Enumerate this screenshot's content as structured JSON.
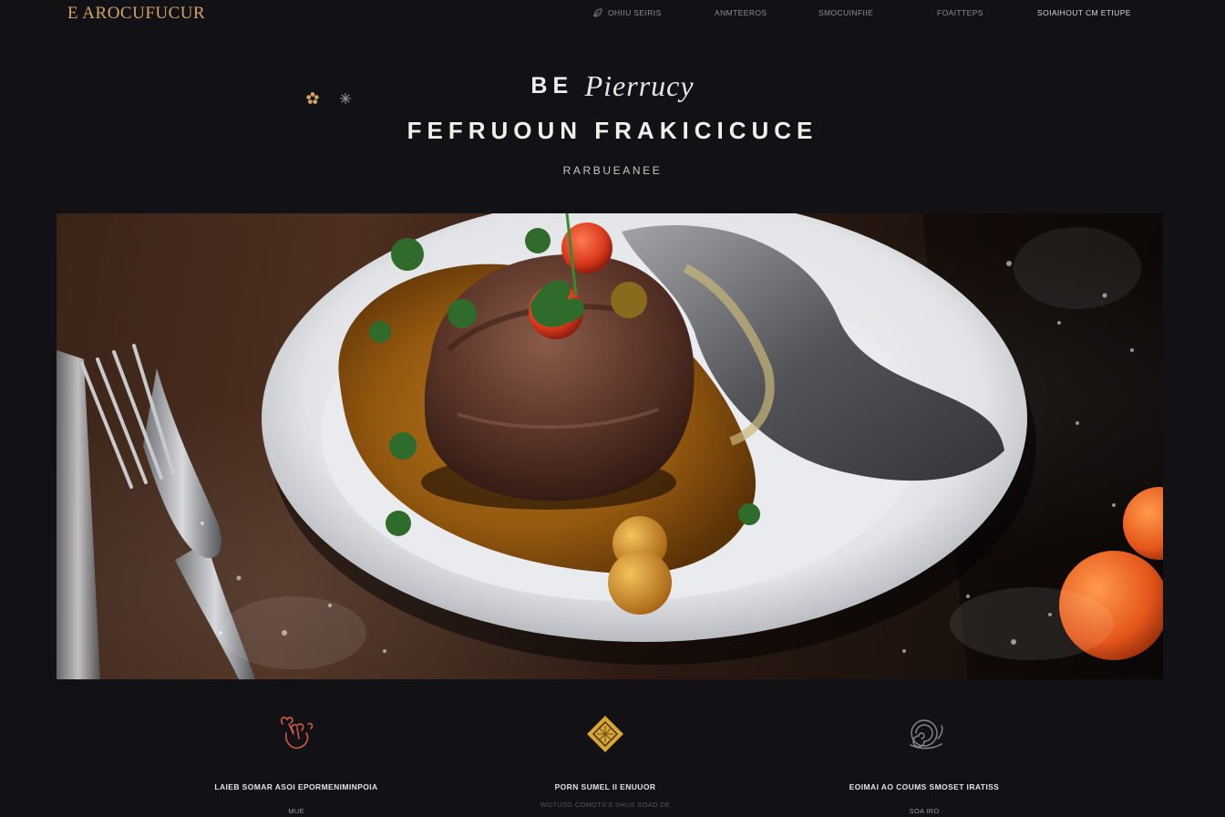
{
  "brand": {
    "logo_text": "E AROCUFUCUR"
  },
  "nav": {
    "links": [
      {
        "label": "OHIIU SEIRIS"
      },
      {
        "label": "ANMTEEROS"
      },
      {
        "label": "SMOCUINFIIE"
      },
      {
        "label": "FOAITTEPS"
      },
      {
        "label": "SOIAIHOUT CM ETIUPE"
      }
    ]
  },
  "hero": {
    "prefix": "BE",
    "script_word": "Pierrucy",
    "title": "FEFRUOUN FRAKICICUCE",
    "subtitle": "RARBUEANEE"
  },
  "features": [
    {
      "title": "LAIEB SOMAR ASOI EPORMENIMINPOIA",
      "subtitle": "MUE",
      "description": ""
    },
    {
      "title": "PORN SUMEL II ENUUOR",
      "subtitle": "",
      "description": "WOTUSG COMOTS'S SHUS SOAD DE"
    },
    {
      "title": "EOIMAI AO COUMS SMOSET IRATISS",
      "subtitle": "SOA IRO",
      "description": ""
    }
  ],
  "icons": {
    "nav_leaf": "leaf-icon",
    "deco_flower": "flower-icon",
    "deco_sparkle": "sparkle-icon",
    "feature_1": "herb-icon",
    "feature_2": "diamond-icon",
    "feature_3": "snail-icon"
  },
  "colors": {
    "background": "#111116",
    "gold": "#d3a35f",
    "coral": "#d25a44",
    "muted": "#8f8f95"
  }
}
